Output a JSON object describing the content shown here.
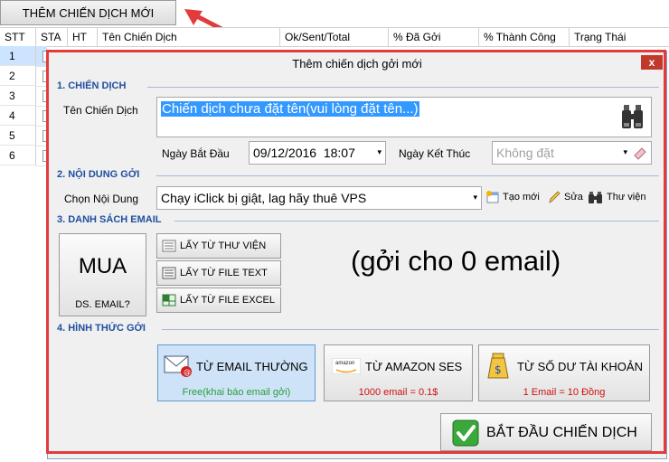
{
  "top_button": {
    "label": "THÊM CHIẾN DỊCH MỚI"
  },
  "table": {
    "columns": [
      "STT",
      "STA",
      "HT",
      "Tên Chiến Dịch",
      "Ok/Sent/Total",
      "% Đã Gởi",
      "% Thành Công",
      "Trạng Thái"
    ],
    "rows": [
      "1",
      "2",
      "3",
      "4",
      "5",
      "6"
    ]
  },
  "dialog": {
    "title": "Thêm chiến dịch gởi mới",
    "close": "x",
    "section1": {
      "heading": "1. CHIẾN DỊCH",
      "name_label": "Tên Chiến Dịch",
      "name_value": "Chiến dịch chưa đặt tên(vui lòng đặt tên...)",
      "start_label": "Ngày Bắt Đầu",
      "start_value": "09/12/2016  18:07",
      "end_label": "Ngày Kết Thúc",
      "end_value": "Không đặt"
    },
    "section2": {
      "heading": "2. NỘI DUNG GỞI",
      "content_label": "Chọn Nội Dung",
      "content_value": "Chạy iClick bị giật, lag hãy thuê VPS",
      "new_label": "Tạo mới",
      "edit_label": "Sửa",
      "library_label": "Thư viện"
    },
    "section3": {
      "heading": "3. DANH SÁCH EMAIL",
      "buy_big": "MUA",
      "buy_small": "DS. EMAIL?",
      "from_library": "LẤY TỪ THƯ VIỆN",
      "from_text": "LẤY TỪ FILE TEXT",
      "from_excel": "LẤY TỪ FILE EXCEL",
      "count_text": "(gởi cho 0 email)"
    },
    "section4": {
      "heading": "4. HÌNH THỨC GỞI",
      "option1_label": "TỪ EMAIL THƯỜNG",
      "option1_sub": "Free(khai báo email gởi)",
      "option2_label": "TỪ AMAZON SES",
      "option2_sub": "1000 email = 0.1$",
      "option3_label": "TỪ SỐ DƯ TÀI KHOẢN",
      "option3_sub": "1 Email = 10 Đồng",
      "amazon_logo_text": "amazon"
    },
    "start_button": "BẮT ĐẦU CHIẾN DỊCH"
  },
  "colors": {
    "section_heading": "#1f4fa0",
    "selected_option_bg": "#cfe3f8",
    "option1_sub": "#2a9d3a",
    "option_sub_red": "#d01010",
    "annotation_red": "#e23b3b",
    "check_green": "#3aa83a"
  }
}
